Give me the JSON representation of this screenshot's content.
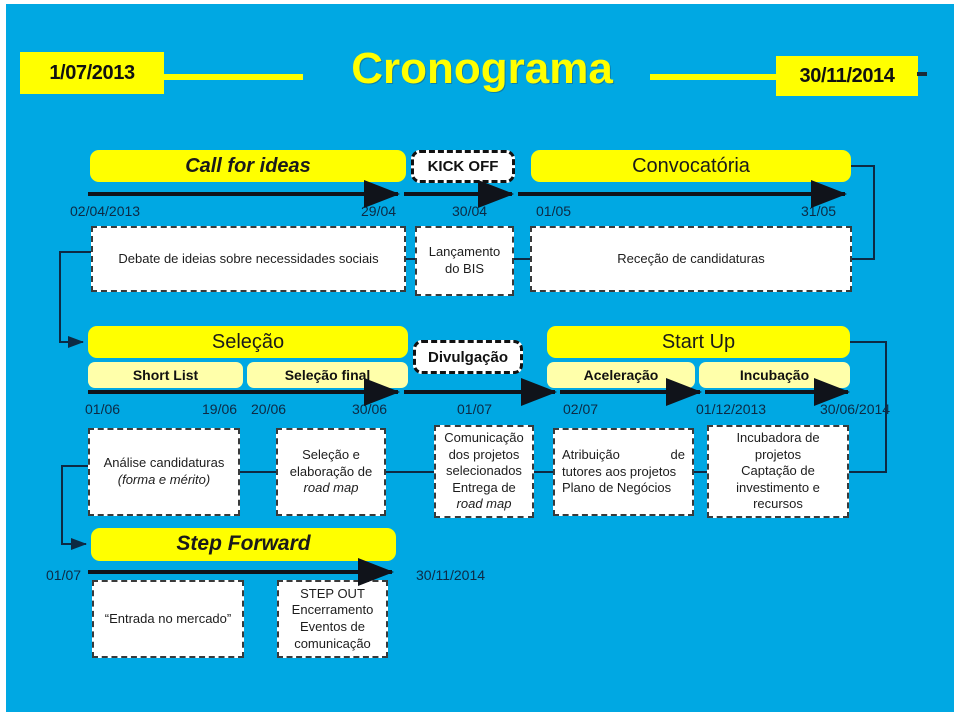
{
  "header": {
    "start_date": "1/07/2013",
    "title": "Cronograma",
    "end_date": "30/11/2014"
  },
  "colors": {
    "background": "#00a8e3",
    "accent_yellow": "#ffff00",
    "sub_yellow": "#ffffaa",
    "card_white": "#ffffff",
    "line_navy": "#0d2a44",
    "text_dark": "#111111"
  },
  "row1": {
    "phases": [
      {
        "label": "Call for ideas",
        "style": "italic"
      },
      {
        "label": "KICK OFF",
        "style": "milestone"
      },
      {
        "label": "Convocatória",
        "style": "plain"
      }
    ],
    "dates": [
      "02/04/2013",
      "29/04",
      "30/04",
      "01/05",
      "31/05"
    ],
    "cards": [
      "Debate de ideias sobre necessidades sociais",
      "Lançamento\ndo BIS",
      "Receção de candidaturas"
    ]
  },
  "row2": {
    "phases": [
      {
        "label": "Seleção",
        "style": "plain"
      },
      {
        "label": "Divulgação",
        "style": "milestone"
      },
      {
        "label": "Start Up",
        "style": "plain"
      }
    ],
    "subphases": [
      "Short List",
      "Seleção final",
      "Aceleração",
      "Incubação"
    ],
    "dates": [
      "01/06",
      "19/06",
      "20/06",
      "30/06",
      "01/07",
      "02/07",
      "01/12/2013",
      "30/06/2014"
    ],
    "cards": [
      {
        "lines": [
          "Análise candidaturas",
          "(forma e mérito)"
        ],
        "italic_lines": [
          1
        ]
      },
      {
        "lines": [
          "Seleção e",
          "elaboração de",
          "road map"
        ],
        "italic_lines": [
          2
        ]
      },
      {
        "lines": [
          "Comunicação",
          "dos projetos",
          "selecionados",
          "Entrega de",
          "road map"
        ],
        "italic_lines": [
          4
        ]
      },
      {
        "lines": [
          "Atribuição           de",
          "tutores aos projetos",
          "Plano de Negócios"
        ],
        "italic_lines": []
      },
      {
        "lines": [
          "Incubadora de",
          "projetos",
          "Captação de",
          "investimento e",
          "recursos"
        ],
        "italic_lines": []
      }
    ]
  },
  "row3": {
    "phase": {
      "label": "Step Forward",
      "style": "italic"
    },
    "dates": [
      "01/07",
      "30/11/2014"
    ],
    "cards": [
      {
        "lines": [
          "“Entrada no mercado”"
        ]
      },
      {
        "lines": [
          "STEP OUT",
          "Encerramento",
          "Eventos de",
          "comunicação"
        ]
      }
    ]
  }
}
